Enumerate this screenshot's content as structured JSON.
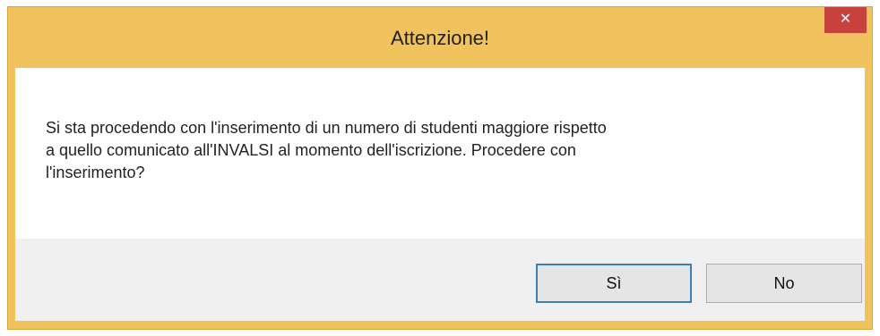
{
  "dialog": {
    "title": "Attenzione!",
    "close_icon": "close-icon",
    "close_glyph": "✕",
    "message_lines": [
      "Si sta procedendo con l'inserimento di un numero di studenti  maggiore rispetto",
      "a quello comunicato all'INVALSI al momento dell'iscrizione. Procedere con",
      "l'inserimento?"
    ],
    "buttons": {
      "yes_label": "Sì",
      "no_label": "No"
    }
  },
  "colors": {
    "title_bar": "#f0c35e",
    "close_button": "#c9413c",
    "focus_border": "#3c7fb1"
  }
}
